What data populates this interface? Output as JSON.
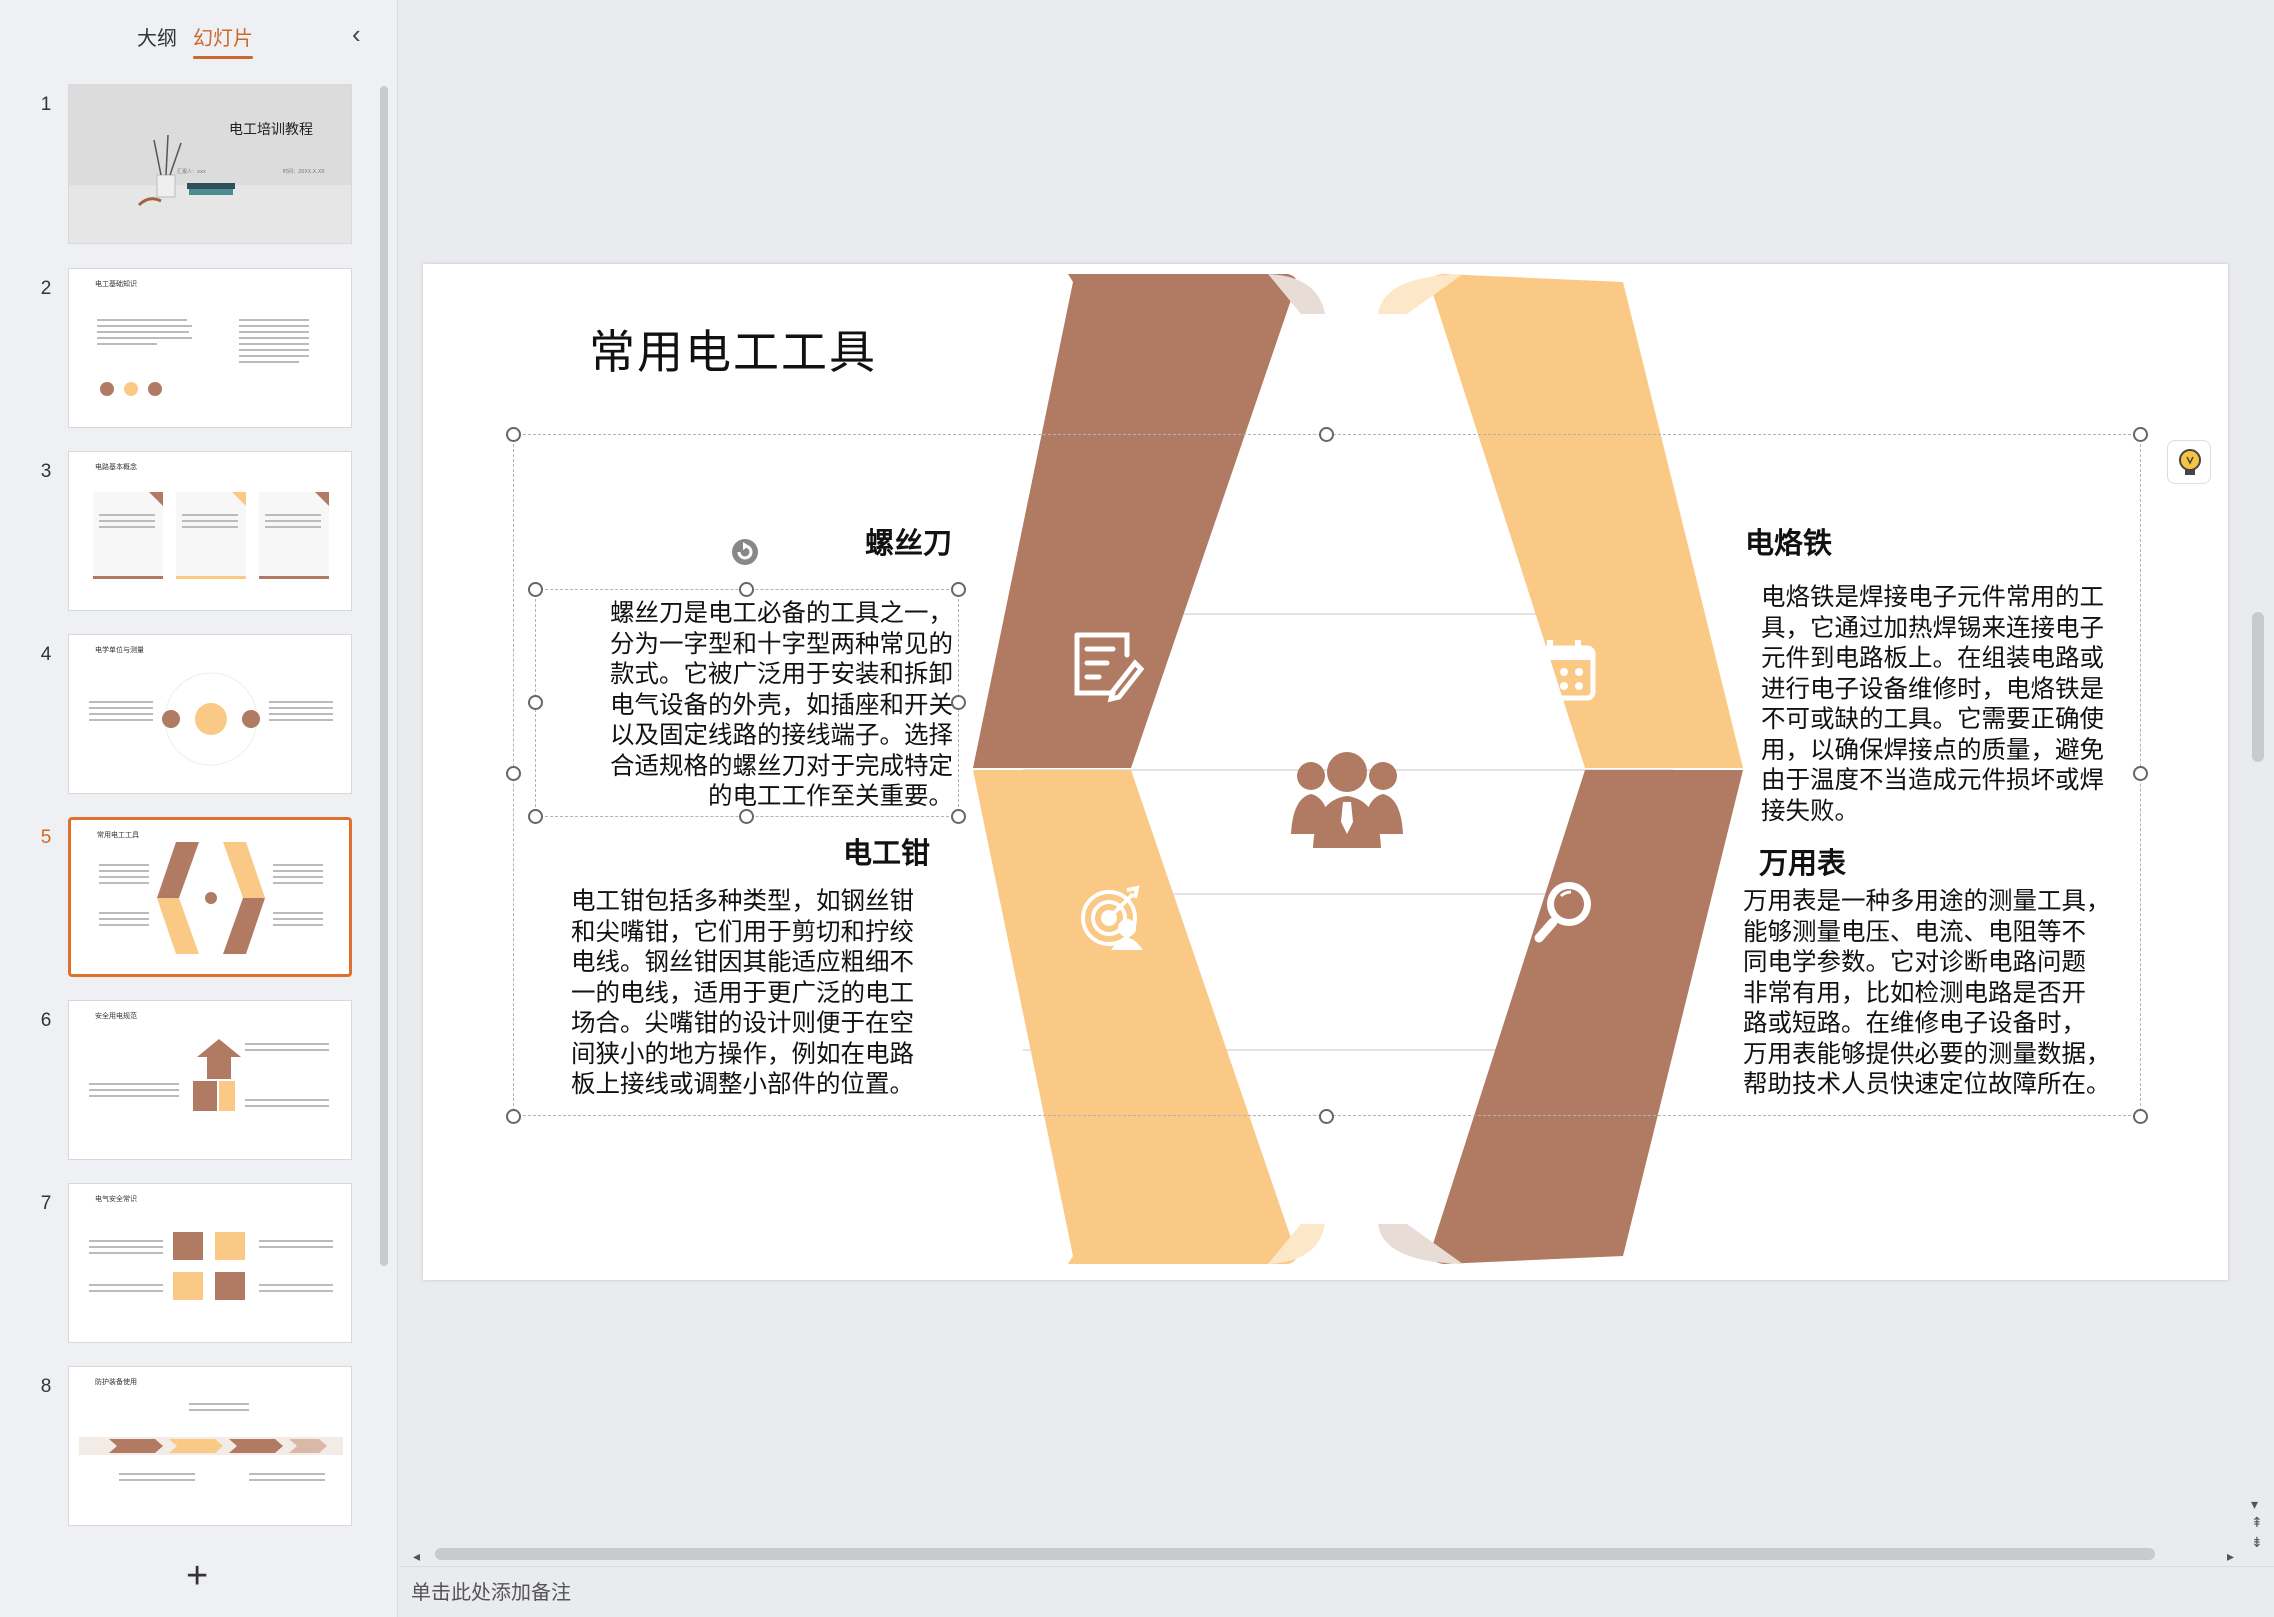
{
  "panel": {
    "tab_outline": "大纲",
    "tab_slides": "幻灯片",
    "collapse": "‹",
    "add_slide": "+"
  },
  "thumbs": [
    {
      "num": "1",
      "title": "电工培训教程"
    },
    {
      "num": "2",
      "title": "电工基础知识"
    },
    {
      "num": "3",
      "title": "电路基本概念"
    },
    {
      "num": "4",
      "title": "电学单位与测量"
    },
    {
      "num": "5",
      "title": "常用电工工具"
    },
    {
      "num": "6",
      "title": "安全用电规范"
    },
    {
      "num": "7",
      "title": "电气安全常识"
    },
    {
      "num": "8",
      "title": "防护装备使用"
    }
  ],
  "slide": {
    "title": "常用电工工具",
    "sections": [
      {
        "title": "螺丝刀",
        "lines": [
          "螺丝刀是电工必备的工具之一，",
          "分为一字型和十字型两种常见的",
          "款式。它被广泛用于安装和拆卸",
          "电气设备的外壳，如插座和开关",
          "以及固定线路的接线端子。选择",
          "合适规格的螺丝刀对于完成特定",
          "的电工工作至关重要。"
        ]
      },
      {
        "title": "电工钳",
        "lines": [
          "电工钳包括多种类型，如钢丝钳",
          "和尖嘴钳，它们用于剪切和拧绞",
          "电线。钢丝钳因其能适应粗细不",
          "一的电线，适用于更广泛的电工",
          "场合。尖嘴钳的设计则便于在空",
          "间狭小的地方操作，例如在电路",
          "板上接线或调整小部件的位置。"
        ]
      },
      {
        "title": "电烙铁",
        "lines": [
          "电烙铁是焊接电子元件常用的工",
          "具，它通过加热焊锡来连接电子",
          "元件到电路板上。在组装电路或",
          "进行电子设备维修时，电烙铁是",
          "不可或缺的工具。它需要正确使",
          "用，以确保焊接点的质量，避免",
          "由于温度不当造成元件损坏或焊",
          "接失败。"
        ]
      },
      {
        "title": "万用表",
        "lines": [
          "万用表是一种多用途的测量工具，",
          "能够测量电压、电流、电阻等不",
          "同电学参数。它对诊断电路问题",
          "非常有用，比如检测电路是否开",
          "路或短路。在维修电子设备时，",
          "万用表能够提供必要的测量数据，",
          "帮助技术人员快速定位故障所在。"
        ]
      }
    ]
  },
  "notes_placeholder": "单击此处添加备注",
  "colors": {
    "brown": "#b07a63",
    "peach": "#f9c985",
    "accent": "#d2691e"
  },
  "icons": [
    "edit-icon",
    "calendar-icon",
    "target-icon",
    "magnifier-icon",
    "team-icon",
    "bulb-icon"
  ]
}
